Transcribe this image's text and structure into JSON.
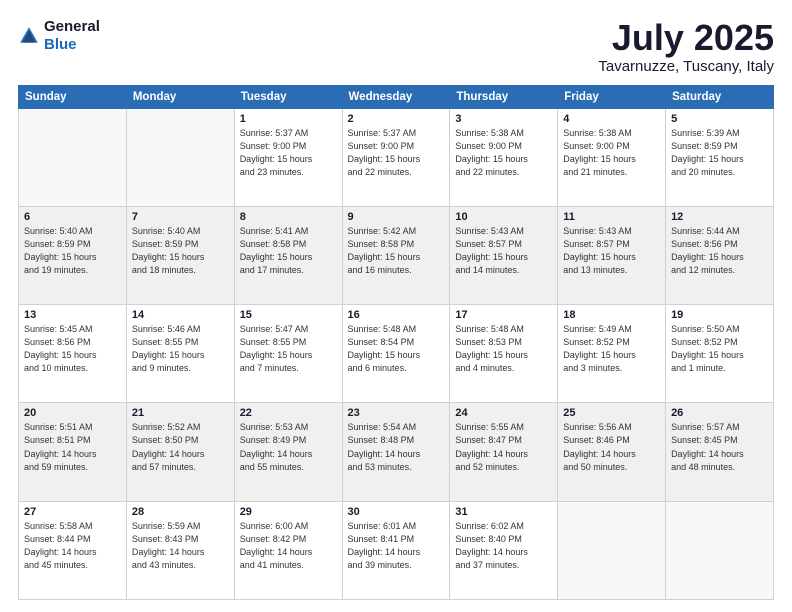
{
  "header": {
    "logo": {
      "general": "General",
      "blue": "Blue"
    },
    "title": "July 2025",
    "location": "Tavarnuzze, Tuscany, Italy"
  },
  "calendar": {
    "days_of_week": [
      "Sunday",
      "Monday",
      "Tuesday",
      "Wednesday",
      "Thursday",
      "Friday",
      "Saturday"
    ],
    "weeks": [
      {
        "shaded": false,
        "days": [
          {
            "num": "",
            "content": ""
          },
          {
            "num": "",
            "content": ""
          },
          {
            "num": "1",
            "content": "Sunrise: 5:37 AM\nSunset: 9:00 PM\nDaylight: 15 hours\nand 23 minutes."
          },
          {
            "num": "2",
            "content": "Sunrise: 5:37 AM\nSunset: 9:00 PM\nDaylight: 15 hours\nand 22 minutes."
          },
          {
            "num": "3",
            "content": "Sunrise: 5:38 AM\nSunset: 9:00 PM\nDaylight: 15 hours\nand 22 minutes."
          },
          {
            "num": "4",
            "content": "Sunrise: 5:38 AM\nSunset: 9:00 PM\nDaylight: 15 hours\nand 21 minutes."
          },
          {
            "num": "5",
            "content": "Sunrise: 5:39 AM\nSunset: 8:59 PM\nDaylight: 15 hours\nand 20 minutes."
          }
        ]
      },
      {
        "shaded": true,
        "days": [
          {
            "num": "6",
            "content": "Sunrise: 5:40 AM\nSunset: 8:59 PM\nDaylight: 15 hours\nand 19 minutes."
          },
          {
            "num": "7",
            "content": "Sunrise: 5:40 AM\nSunset: 8:59 PM\nDaylight: 15 hours\nand 18 minutes."
          },
          {
            "num": "8",
            "content": "Sunrise: 5:41 AM\nSunset: 8:58 PM\nDaylight: 15 hours\nand 17 minutes."
          },
          {
            "num": "9",
            "content": "Sunrise: 5:42 AM\nSunset: 8:58 PM\nDaylight: 15 hours\nand 16 minutes."
          },
          {
            "num": "10",
            "content": "Sunrise: 5:43 AM\nSunset: 8:57 PM\nDaylight: 15 hours\nand 14 minutes."
          },
          {
            "num": "11",
            "content": "Sunrise: 5:43 AM\nSunset: 8:57 PM\nDaylight: 15 hours\nand 13 minutes."
          },
          {
            "num": "12",
            "content": "Sunrise: 5:44 AM\nSunset: 8:56 PM\nDaylight: 15 hours\nand 12 minutes."
          }
        ]
      },
      {
        "shaded": false,
        "days": [
          {
            "num": "13",
            "content": "Sunrise: 5:45 AM\nSunset: 8:56 PM\nDaylight: 15 hours\nand 10 minutes."
          },
          {
            "num": "14",
            "content": "Sunrise: 5:46 AM\nSunset: 8:55 PM\nDaylight: 15 hours\nand 9 minutes."
          },
          {
            "num": "15",
            "content": "Sunrise: 5:47 AM\nSunset: 8:55 PM\nDaylight: 15 hours\nand 7 minutes."
          },
          {
            "num": "16",
            "content": "Sunrise: 5:48 AM\nSunset: 8:54 PM\nDaylight: 15 hours\nand 6 minutes."
          },
          {
            "num": "17",
            "content": "Sunrise: 5:48 AM\nSunset: 8:53 PM\nDaylight: 15 hours\nand 4 minutes."
          },
          {
            "num": "18",
            "content": "Sunrise: 5:49 AM\nSunset: 8:52 PM\nDaylight: 15 hours\nand 3 minutes."
          },
          {
            "num": "19",
            "content": "Sunrise: 5:50 AM\nSunset: 8:52 PM\nDaylight: 15 hours\nand 1 minute."
          }
        ]
      },
      {
        "shaded": true,
        "days": [
          {
            "num": "20",
            "content": "Sunrise: 5:51 AM\nSunset: 8:51 PM\nDaylight: 14 hours\nand 59 minutes."
          },
          {
            "num": "21",
            "content": "Sunrise: 5:52 AM\nSunset: 8:50 PM\nDaylight: 14 hours\nand 57 minutes."
          },
          {
            "num": "22",
            "content": "Sunrise: 5:53 AM\nSunset: 8:49 PM\nDaylight: 14 hours\nand 55 minutes."
          },
          {
            "num": "23",
            "content": "Sunrise: 5:54 AM\nSunset: 8:48 PM\nDaylight: 14 hours\nand 53 minutes."
          },
          {
            "num": "24",
            "content": "Sunrise: 5:55 AM\nSunset: 8:47 PM\nDaylight: 14 hours\nand 52 minutes."
          },
          {
            "num": "25",
            "content": "Sunrise: 5:56 AM\nSunset: 8:46 PM\nDaylight: 14 hours\nand 50 minutes."
          },
          {
            "num": "26",
            "content": "Sunrise: 5:57 AM\nSunset: 8:45 PM\nDaylight: 14 hours\nand 48 minutes."
          }
        ]
      },
      {
        "shaded": false,
        "days": [
          {
            "num": "27",
            "content": "Sunrise: 5:58 AM\nSunset: 8:44 PM\nDaylight: 14 hours\nand 45 minutes."
          },
          {
            "num": "28",
            "content": "Sunrise: 5:59 AM\nSunset: 8:43 PM\nDaylight: 14 hours\nand 43 minutes."
          },
          {
            "num": "29",
            "content": "Sunrise: 6:00 AM\nSunset: 8:42 PM\nDaylight: 14 hours\nand 41 minutes."
          },
          {
            "num": "30",
            "content": "Sunrise: 6:01 AM\nSunset: 8:41 PM\nDaylight: 14 hours\nand 39 minutes."
          },
          {
            "num": "31",
            "content": "Sunrise: 6:02 AM\nSunset: 8:40 PM\nDaylight: 14 hours\nand 37 minutes."
          },
          {
            "num": "",
            "content": ""
          },
          {
            "num": "",
            "content": ""
          }
        ]
      }
    ]
  }
}
